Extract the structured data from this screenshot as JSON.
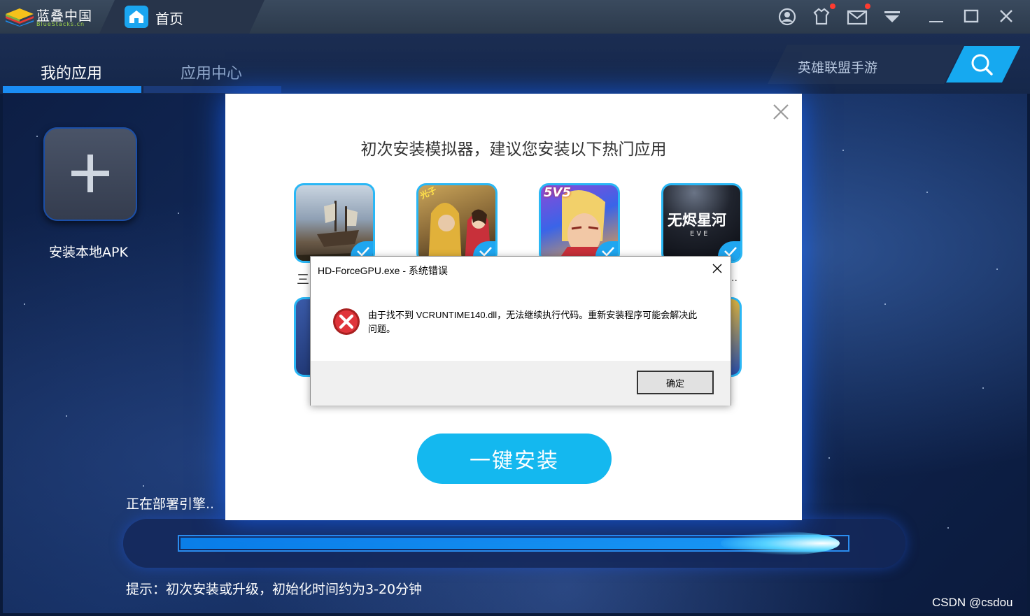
{
  "app": {
    "brand_cn": "蓝叠中国",
    "brand_en": "BlueStacks.cn",
    "home_tab": "首页"
  },
  "nav": {
    "tabs": [
      {
        "label": "我的应用",
        "active": true
      },
      {
        "label": "应用中心",
        "active": false
      }
    ],
    "search_text": "英雄联盟手游"
  },
  "sidebar": {
    "install_apk_label": "安装本地APK"
  },
  "dialog": {
    "title": "初次安装模拟器，建议您安装以下热门应用",
    "partial_left": "三",
    "partial_right": "..",
    "app_icons": [
      {
        "name": "pirate-ship-game",
        "checked": true,
        "text": ""
      },
      {
        "name": "pubg-mobile",
        "checked": true,
        "text": "光子"
      },
      {
        "name": "honor-of-kings",
        "checked": true,
        "text": "5V5"
      },
      {
        "name": "eve-echoes",
        "checked": true,
        "text": "无烬星河"
      },
      {
        "name": "eve-echoes-sub",
        "checked": true,
        "text": "EVE"
      }
    ],
    "install_button": "一键安装"
  },
  "error_dialog": {
    "title": "HD-ForceGPU.exe - 系统错误",
    "message": "由于找不到 VCRUNTIME140.dll，无法继续执行代码。重新安装程序可能会解决此问题。",
    "ok_button": "确定"
  },
  "status": {
    "deploying": "正在部署引擎..",
    "progress": 0.98,
    "hint": "提示：初次安装或升级，初始化时间约为3-20分钟"
  },
  "watermark": "CSDN @csdou",
  "colors": {
    "accent": "#14b8ef",
    "titlebar": "#34445a",
    "nav_bg": "#1b2d52",
    "error_red": "#d9262b"
  }
}
